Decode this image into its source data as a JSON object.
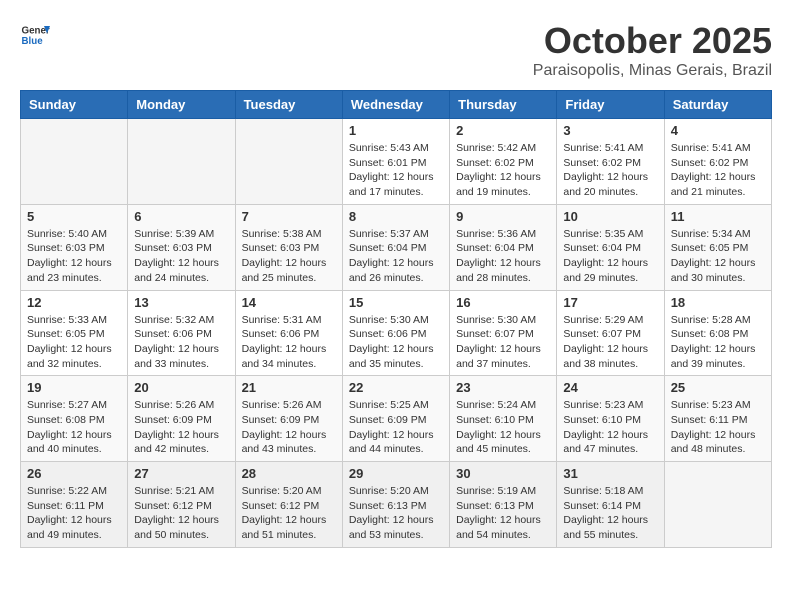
{
  "header": {
    "logo_general": "General",
    "logo_blue": "Blue",
    "month_title": "October 2025",
    "location": "Paraisopolis, Minas Gerais, Brazil"
  },
  "weekdays": [
    "Sunday",
    "Monday",
    "Tuesday",
    "Wednesday",
    "Thursday",
    "Friday",
    "Saturday"
  ],
  "weeks": [
    [
      {
        "day": "",
        "info": ""
      },
      {
        "day": "",
        "info": ""
      },
      {
        "day": "",
        "info": ""
      },
      {
        "day": "1",
        "info": "Sunrise: 5:43 AM\nSunset: 6:01 PM\nDaylight: 12 hours\nand 17 minutes."
      },
      {
        "day": "2",
        "info": "Sunrise: 5:42 AM\nSunset: 6:02 PM\nDaylight: 12 hours\nand 19 minutes."
      },
      {
        "day": "3",
        "info": "Sunrise: 5:41 AM\nSunset: 6:02 PM\nDaylight: 12 hours\nand 20 minutes."
      },
      {
        "day": "4",
        "info": "Sunrise: 5:41 AM\nSunset: 6:02 PM\nDaylight: 12 hours\nand 21 minutes."
      }
    ],
    [
      {
        "day": "5",
        "info": "Sunrise: 5:40 AM\nSunset: 6:03 PM\nDaylight: 12 hours\nand 23 minutes."
      },
      {
        "day": "6",
        "info": "Sunrise: 5:39 AM\nSunset: 6:03 PM\nDaylight: 12 hours\nand 24 minutes."
      },
      {
        "day": "7",
        "info": "Sunrise: 5:38 AM\nSunset: 6:03 PM\nDaylight: 12 hours\nand 25 minutes."
      },
      {
        "day": "8",
        "info": "Sunrise: 5:37 AM\nSunset: 6:04 PM\nDaylight: 12 hours\nand 26 minutes."
      },
      {
        "day": "9",
        "info": "Sunrise: 5:36 AM\nSunset: 6:04 PM\nDaylight: 12 hours\nand 28 minutes."
      },
      {
        "day": "10",
        "info": "Sunrise: 5:35 AM\nSunset: 6:04 PM\nDaylight: 12 hours\nand 29 minutes."
      },
      {
        "day": "11",
        "info": "Sunrise: 5:34 AM\nSunset: 6:05 PM\nDaylight: 12 hours\nand 30 minutes."
      }
    ],
    [
      {
        "day": "12",
        "info": "Sunrise: 5:33 AM\nSunset: 6:05 PM\nDaylight: 12 hours\nand 32 minutes."
      },
      {
        "day": "13",
        "info": "Sunrise: 5:32 AM\nSunset: 6:06 PM\nDaylight: 12 hours\nand 33 minutes."
      },
      {
        "day": "14",
        "info": "Sunrise: 5:31 AM\nSunset: 6:06 PM\nDaylight: 12 hours\nand 34 minutes."
      },
      {
        "day": "15",
        "info": "Sunrise: 5:30 AM\nSunset: 6:06 PM\nDaylight: 12 hours\nand 35 minutes."
      },
      {
        "day": "16",
        "info": "Sunrise: 5:30 AM\nSunset: 6:07 PM\nDaylight: 12 hours\nand 37 minutes."
      },
      {
        "day": "17",
        "info": "Sunrise: 5:29 AM\nSunset: 6:07 PM\nDaylight: 12 hours\nand 38 minutes."
      },
      {
        "day": "18",
        "info": "Sunrise: 5:28 AM\nSunset: 6:08 PM\nDaylight: 12 hours\nand 39 minutes."
      }
    ],
    [
      {
        "day": "19",
        "info": "Sunrise: 5:27 AM\nSunset: 6:08 PM\nDaylight: 12 hours\nand 40 minutes."
      },
      {
        "day": "20",
        "info": "Sunrise: 5:26 AM\nSunset: 6:09 PM\nDaylight: 12 hours\nand 42 minutes."
      },
      {
        "day": "21",
        "info": "Sunrise: 5:26 AM\nSunset: 6:09 PM\nDaylight: 12 hours\nand 43 minutes."
      },
      {
        "day": "22",
        "info": "Sunrise: 5:25 AM\nSunset: 6:09 PM\nDaylight: 12 hours\nand 44 minutes."
      },
      {
        "day": "23",
        "info": "Sunrise: 5:24 AM\nSunset: 6:10 PM\nDaylight: 12 hours\nand 45 minutes."
      },
      {
        "day": "24",
        "info": "Sunrise: 5:23 AM\nSunset: 6:10 PM\nDaylight: 12 hours\nand 47 minutes."
      },
      {
        "day": "25",
        "info": "Sunrise: 5:23 AM\nSunset: 6:11 PM\nDaylight: 12 hours\nand 48 minutes."
      }
    ],
    [
      {
        "day": "26",
        "info": "Sunrise: 5:22 AM\nSunset: 6:11 PM\nDaylight: 12 hours\nand 49 minutes."
      },
      {
        "day": "27",
        "info": "Sunrise: 5:21 AM\nSunset: 6:12 PM\nDaylight: 12 hours\nand 50 minutes."
      },
      {
        "day": "28",
        "info": "Sunrise: 5:20 AM\nSunset: 6:12 PM\nDaylight: 12 hours\nand 51 minutes."
      },
      {
        "day": "29",
        "info": "Sunrise: 5:20 AM\nSunset: 6:13 PM\nDaylight: 12 hours\nand 53 minutes."
      },
      {
        "day": "30",
        "info": "Sunrise: 5:19 AM\nSunset: 6:13 PM\nDaylight: 12 hours\nand 54 minutes."
      },
      {
        "day": "31",
        "info": "Sunrise: 5:18 AM\nSunset: 6:14 PM\nDaylight: 12 hours\nand 55 minutes."
      },
      {
        "day": "",
        "info": ""
      }
    ]
  ]
}
